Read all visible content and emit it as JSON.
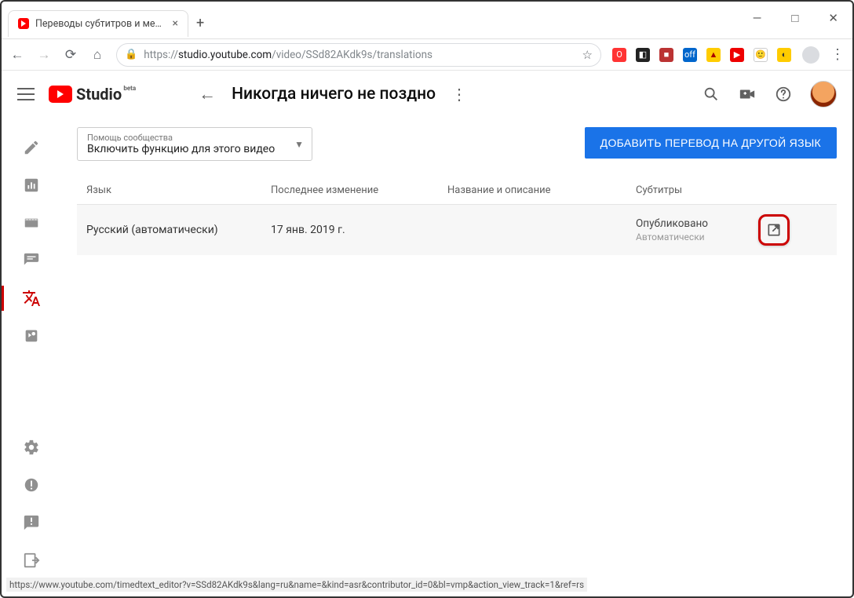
{
  "window": {
    "tab_title": "Переводы субтитров и метадан..."
  },
  "browser": {
    "url_host": "https://",
    "url_domain": "studio.youtube.com",
    "url_path": "/video/SSd82AKdk9s/translations",
    "status_url": "https://www.youtube.com/timedtext_editor?v=SSd82AKdk9s&lang=ru&name=&kind=asr&contributor_id=0&bl=vmp&action_view_track=1&ref=rs"
  },
  "studio": {
    "logo_text": "Studio",
    "beta": "beta",
    "page_title": "Никогда ничего не поздно"
  },
  "dropdown": {
    "label": "Помощь сообщества",
    "value": "Включить функцию для этого видео"
  },
  "add_button": "ДОБАВИТЬ ПЕРЕВОД НА ДРУГОЙ ЯЗЫК",
  "columns": {
    "lang": "Язык",
    "modified": "Последнее изменение",
    "title_desc": "Название и описание",
    "subs": "Субтитры"
  },
  "rows": [
    {
      "language": "Русский (автоматически)",
      "modified": "17 янв. 2019 г.",
      "title_desc": "",
      "sub_status": "Опубликовано",
      "sub_auto": "Автоматически"
    }
  ]
}
